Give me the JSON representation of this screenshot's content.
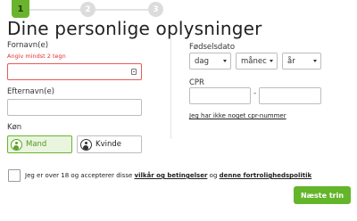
{
  "steps": [
    {
      "number": "1",
      "active": true
    },
    {
      "number": "2",
      "active": false
    },
    {
      "number": "3",
      "active": false
    }
  ],
  "title": "Dine personlige oplysninger",
  "fields": {
    "first_name": {
      "label": "Fornavn(e)",
      "error": "Angiv mindst 2 tegn",
      "value": ""
    },
    "last_name": {
      "label": "Efternavn(e)",
      "value": ""
    },
    "gender": {
      "label": "Køn",
      "options": [
        "Mand",
        "Kvinde"
      ],
      "selected": "Mand"
    },
    "birthdate": {
      "label": "Fødselsdato",
      "day": "dag",
      "month": "månec",
      "year": "år"
    },
    "cpr": {
      "label": "CPR",
      "separator": "-",
      "no_cpr_link": "Jeg har ikke noget cpr-nummer"
    }
  },
  "terms": {
    "prefix": "Jeg er over 18 og accepterer disse",
    "link1": "vilkår og betingelser",
    "middle": "og",
    "link2": "denne fortrolighedspolitik"
  },
  "next_button": "Næste trin",
  "colors": {
    "accent": "#64b52a",
    "error": "#e0312f"
  }
}
